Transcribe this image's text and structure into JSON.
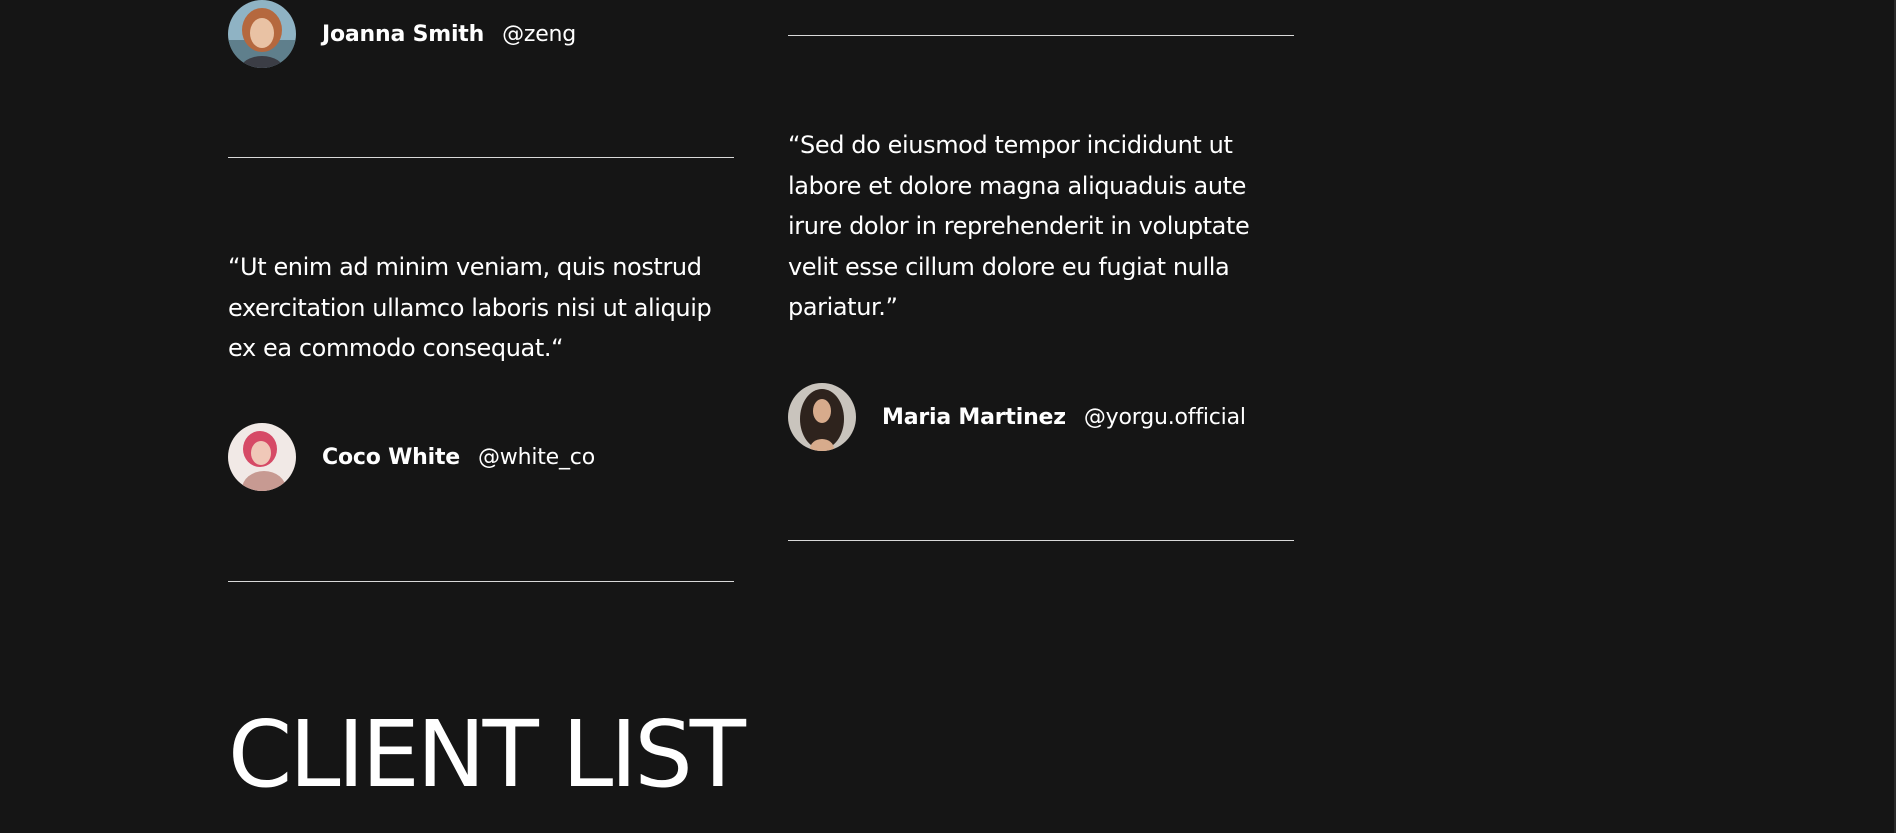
{
  "testimonials": {
    "left": [
      {
        "author": {
          "name": "Joanna Smith",
          "handle": "@zeng",
          "avatar": "joanna-avatar"
        }
      },
      {
        "quote_lines": [
          "“Ut enim ad minim veniam, quis nostrud",
          "exercitation ullamco laboris nisi ut aliquip",
          "ex ea commodo consequat.“"
        ],
        "author": {
          "name": "Coco White",
          "handle": "@white_co",
          "avatar": "coco-avatar"
        }
      }
    ],
    "right": [
      {
        "quote_lines": [
          "“Sed do eiusmod tempor incididunt ut",
          "labore et dolore magna aliquaduis aute",
          "irure dolor in reprehenderit in voluptate",
          "velit esse cillum dolore eu fugiat nulla",
          "pariatur.”"
        ],
        "author": {
          "name": "Maria Martinez",
          "handle": "@yorgu.official",
          "avatar": "maria-avatar"
        }
      }
    ]
  },
  "client_list": {
    "heading": "CLIENT LIST"
  },
  "colors": {
    "background": "#151515",
    "text": "#ffffff",
    "divider": "#d9d9d9"
  }
}
